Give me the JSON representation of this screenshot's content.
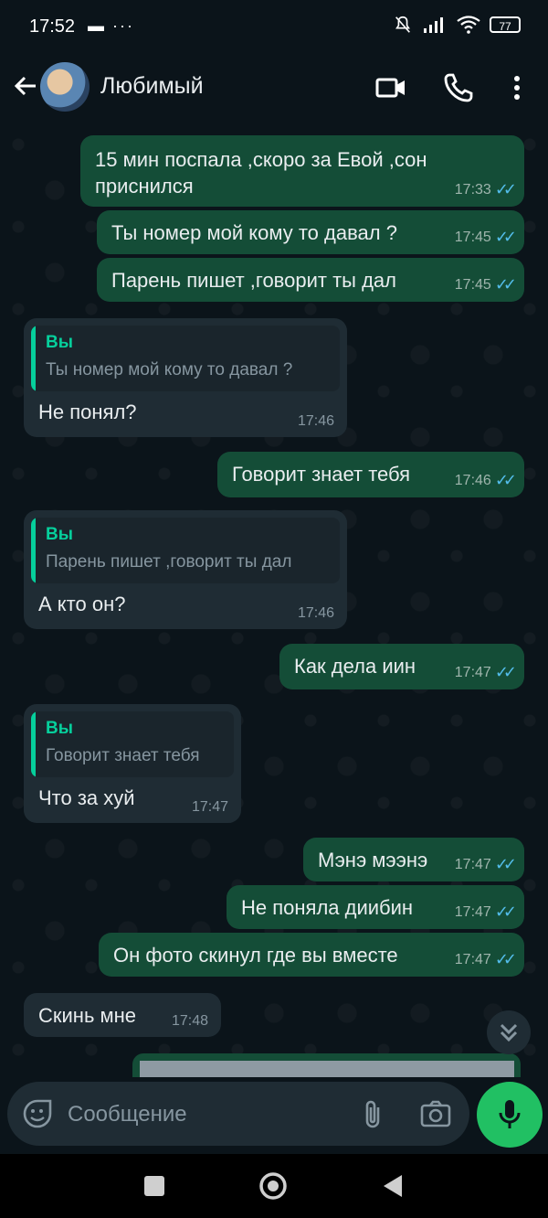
{
  "status_bar": {
    "time": "17:52",
    "left_icons": "▬ ···",
    "battery": "77",
    "icons": [
      "notifications-off-icon",
      "signal-icon",
      "wifi-icon",
      "battery-icon"
    ]
  },
  "header": {
    "contact_name": "Любимый",
    "icons": [
      "back-arrow-icon",
      "avatar",
      "video-call-icon",
      "phone-icon",
      "more-vert-icon"
    ]
  },
  "messages": [
    {
      "dir": "out",
      "text": "15 мин поспала ,скоро за Евой ,сон приснился",
      "time": "17:33",
      "read": true
    },
    {
      "dir": "out",
      "text": "Ты номер мой кому то давал ?",
      "time": "17:45",
      "read": true
    },
    {
      "dir": "out",
      "text": "Парень пишет ,говорит ты дал",
      "time": "17:45",
      "read": true
    },
    {
      "dir": "in",
      "quote_author": "Вы",
      "quote_text": "Ты номер мой кому то давал ?",
      "text": "Не понял?",
      "time": "17:46"
    },
    {
      "dir": "out",
      "text": "Говорит знает тебя",
      "time": "17:46",
      "read": true
    },
    {
      "dir": "in",
      "quote_author": "Вы",
      "quote_text": "Парень пишет ,говорит ты дал",
      "text": "А кто он?",
      "time": "17:46"
    },
    {
      "dir": "out",
      "text": "Как дела иин",
      "time": "17:47",
      "read": true
    },
    {
      "dir": "in",
      "quote_author": "Вы",
      "quote_text": "Говорит знает тебя",
      "text": "Что за хуй",
      "time": "17:47"
    },
    {
      "dir": "out",
      "text": "Мэнэ мээнэ",
      "time": "17:47",
      "read": true
    },
    {
      "dir": "out",
      "text": "Не поняла диибин",
      "time": "17:47",
      "read": true
    },
    {
      "dir": "out",
      "text": "Он фото скинул где вы вместе",
      "time": "17:47",
      "read": true
    },
    {
      "dir": "in",
      "text": "Скинь мне",
      "time": "17:48"
    }
  ],
  "composer": {
    "placeholder": "Сообщение",
    "icons": [
      "emoji-sticker-icon",
      "attach-icon",
      "camera-icon",
      "mic-icon"
    ]
  },
  "scroll_down": {
    "icon": "double-chevron-down-icon"
  },
  "nav_bar": {
    "icons": [
      "recents-square-icon",
      "home-circle-icon",
      "back-triangle-icon"
    ]
  },
  "colors": {
    "outgoing": "#144d37",
    "incoming": "#1f2c34",
    "accent": "#21c063",
    "read_ticks": "#53bdeb",
    "quote_accent": "#06cf9c"
  }
}
